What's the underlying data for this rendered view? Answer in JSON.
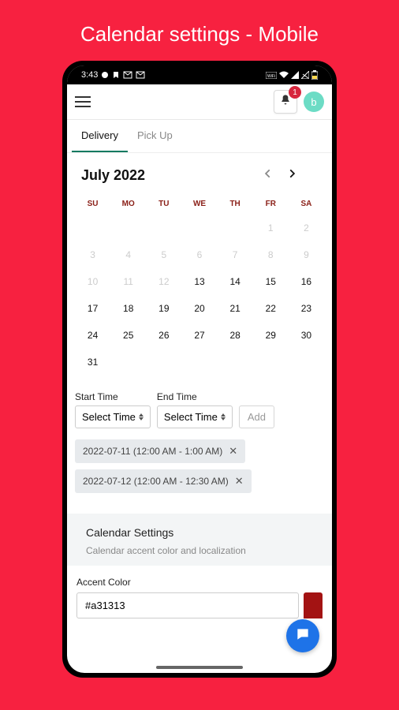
{
  "page": {
    "title": "Calendar settings - Mobile"
  },
  "status": {
    "time": "3:43"
  },
  "header": {
    "badge": "1",
    "avatar_initial": "b"
  },
  "tabs": [
    {
      "label": "Delivery",
      "active": true
    },
    {
      "label": "Pick Up",
      "active": false
    }
  ],
  "calendar": {
    "title": "July 2022",
    "days_of_week": [
      "SU",
      "MO",
      "TU",
      "WE",
      "TH",
      "FR",
      "SA"
    ],
    "cells": [
      {
        "d": "",
        "t": "empty"
      },
      {
        "d": "",
        "t": "empty"
      },
      {
        "d": "",
        "t": "empty"
      },
      {
        "d": "",
        "t": "empty"
      },
      {
        "d": "",
        "t": "empty"
      },
      {
        "d": "1",
        "t": "dim"
      },
      {
        "d": "2",
        "t": "dim"
      },
      {
        "d": "3",
        "t": "dim"
      },
      {
        "d": "4",
        "t": "dim"
      },
      {
        "d": "5",
        "t": "dim"
      },
      {
        "d": "6",
        "t": "dim"
      },
      {
        "d": "7",
        "t": "dim"
      },
      {
        "d": "8",
        "t": "dim"
      },
      {
        "d": "9",
        "t": "dim"
      },
      {
        "d": "10",
        "t": "dim"
      },
      {
        "d": "11",
        "t": "dim"
      },
      {
        "d": "12",
        "t": "dim"
      },
      {
        "d": "13",
        "t": "norm"
      },
      {
        "d": "14",
        "t": "norm"
      },
      {
        "d": "15",
        "t": "norm"
      },
      {
        "d": "16",
        "t": "norm"
      },
      {
        "d": "17",
        "t": "norm"
      },
      {
        "d": "18",
        "t": "norm"
      },
      {
        "d": "19",
        "t": "norm"
      },
      {
        "d": "20",
        "t": "norm"
      },
      {
        "d": "21",
        "t": "norm"
      },
      {
        "d": "22",
        "t": "norm"
      },
      {
        "d": "23",
        "t": "norm"
      },
      {
        "d": "24",
        "t": "norm"
      },
      {
        "d": "25",
        "t": "norm"
      },
      {
        "d": "26",
        "t": "norm"
      },
      {
        "d": "27",
        "t": "norm"
      },
      {
        "d": "28",
        "t": "norm"
      },
      {
        "d": "29",
        "t": "norm"
      },
      {
        "d": "30",
        "t": "norm"
      },
      {
        "d": "31",
        "t": "norm"
      }
    ]
  },
  "time_picker": {
    "start_label": "Start Time",
    "end_label": "End Time",
    "select_placeholder": "Select Time",
    "add_label": "Add"
  },
  "slots": [
    "2022-07-11 (12:00 AM - 1:00 AM)",
    "2022-07-12 (12:00 AM - 12:30 AM)"
  ],
  "settings": {
    "title": "Calendar Settings",
    "desc": "Calendar accent color and localization",
    "accent_label": "Accent Color",
    "accent_value": "#a31313"
  }
}
